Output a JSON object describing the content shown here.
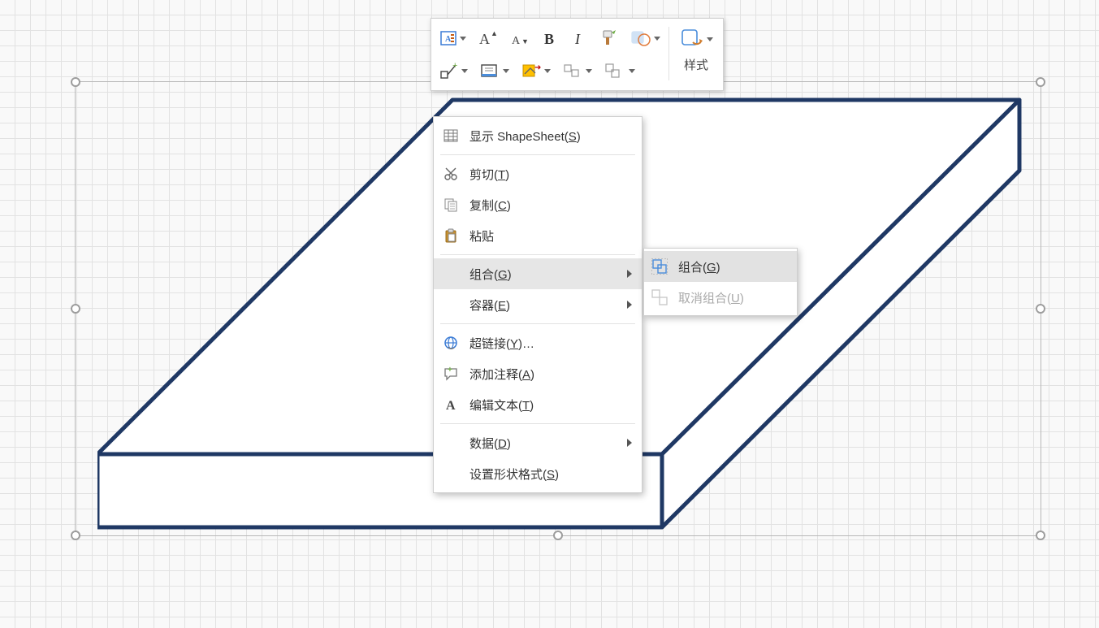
{
  "context_menu": {
    "shapesheet": "显示 ShapeSheet(S)",
    "cut": "剪切(T)",
    "copy": "复制(C)",
    "paste": "粘贴",
    "group": "组合(G)",
    "container": "容器(E)",
    "hyperlink": "超链接(Y)…",
    "comment": "添加注释(A)",
    "edit_text": "编辑文本(T)",
    "data": "数据(D)",
    "format_shape": "设置形状格式(S)"
  },
  "submenu": {
    "group": "组合(G)",
    "ungroup": "取消组合(U)"
  },
  "mini_toolbar": {
    "styles_label": "样式"
  }
}
